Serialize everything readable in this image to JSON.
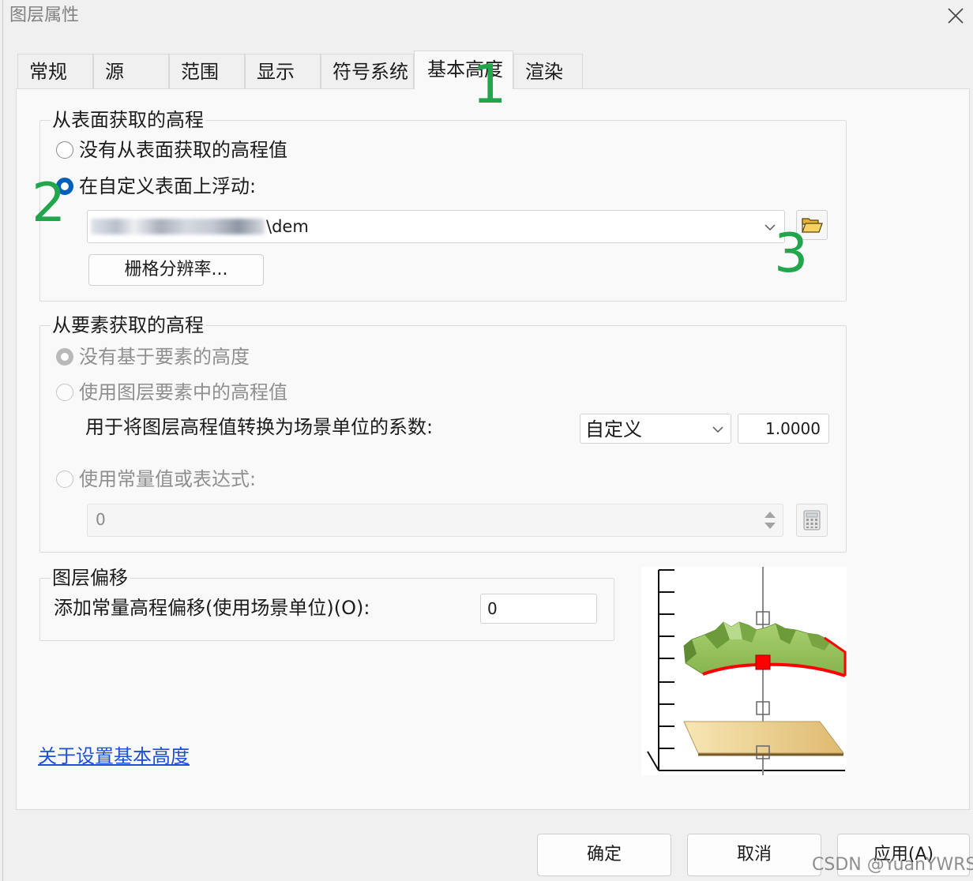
{
  "window": {
    "title": "图层属性"
  },
  "tabs": [
    {
      "label": "常规",
      "selected": false
    },
    {
      "label": "源",
      "selected": false
    },
    {
      "label": "范围",
      "selected": false
    },
    {
      "label": "显示",
      "selected": false
    },
    {
      "label": "符号系统",
      "selected": false
    },
    {
      "label": "基本高度",
      "selected": true
    },
    {
      "label": "渲染",
      "selected": false
    }
  ],
  "annotations": {
    "tab_marker": "1",
    "radio_marker": "2",
    "browse_marker": "3"
  },
  "surface_elevation": {
    "legend": "从表面获取的高程",
    "no_surface_label": "没有从表面获取的高程值",
    "no_surface_checked": false,
    "custom_surface_label": "在自定义表面上浮动:",
    "custom_surface_checked": true,
    "surface_path": "\\dem",
    "raster_resolution_button": "栅格分辨率..."
  },
  "feature_elevation": {
    "legend": "从要素获取的高程",
    "enabled": false,
    "no_feature_label": "没有基于要素的高度",
    "no_feature_checked": true,
    "layer_values_label": "使用图层要素中的高程值",
    "conversion_factor_label": "用于将图层高程值转换为场景单位的系数:",
    "conversion_unit": "自定义",
    "conversion_factor": "1.0000",
    "expression_label": "使用常量值或表达式:",
    "expression_value": "0"
  },
  "layer_offset": {
    "legend": "图层偏移",
    "label": "添加常量高程偏移(使用场景单位)(O):",
    "value": "0"
  },
  "help_link": "关于设置基本高度",
  "buttons": {
    "ok": "确定",
    "cancel": "取消",
    "apply": "应用(A)"
  },
  "watermark": "CSDN @YuanYWRS",
  "icons": {
    "close": "close-icon",
    "dropdown": "chevron-down-icon",
    "browse": "folder-open-icon",
    "calculator": "calculator-icon",
    "spinner": "spinner-arrows-icon"
  },
  "colors": {
    "accent": "#005fb8",
    "annotation": "#21a64b",
    "link": "#1d4fd8",
    "terrain": "#8dbb54",
    "terrain_edge": "#ff0000",
    "base_plane": "#e0bd74"
  }
}
